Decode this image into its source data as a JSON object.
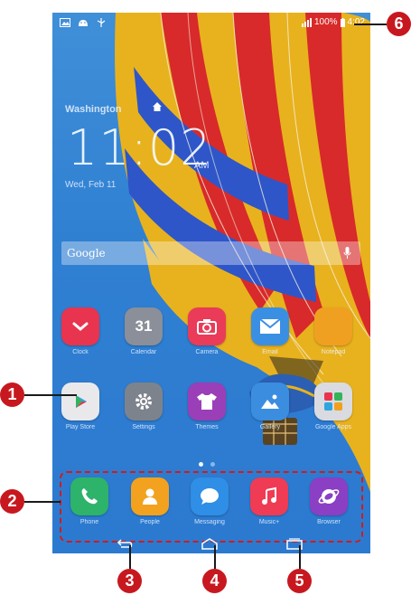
{
  "status_bar": {
    "left_icons": [
      "image-icon",
      "android-icon",
      "usb-icon"
    ],
    "signal": "signal-icon",
    "battery_text": "100%",
    "time": "4:02"
  },
  "widget": {
    "location": "Washington",
    "time": "11:02",
    "ampm": "AM",
    "date": "Wed, Feb 11"
  },
  "search": {
    "logo": "Google"
  },
  "apps_row1": [
    {
      "label": "Clock",
      "icon": "clock-icon",
      "color": "#e8344e"
    },
    {
      "label": "Calendar",
      "icon": "calendar-icon",
      "color": "#8a8f99",
      "text": "31"
    },
    {
      "label": "Camera",
      "icon": "camera-icon",
      "color": "#ea3b58"
    },
    {
      "label": "Email",
      "icon": "email-icon",
      "color": "#3a8fe3"
    },
    {
      "label": "Notepad",
      "icon": "notepad-icon",
      "color": "#f0a020"
    }
  ],
  "apps_row2": [
    {
      "label": "Play Store",
      "icon": "play-store-icon",
      "color": "#e9e9ec"
    },
    {
      "label": "Settings",
      "icon": "settings-icon",
      "color": "#7d838c"
    },
    {
      "label": "Themes",
      "icon": "themes-icon",
      "color": "#9a3fb8"
    },
    {
      "label": "Gallery",
      "icon": "gallery-icon",
      "color": "#3b8de0"
    },
    {
      "label": "Google Apps",
      "icon": "folder-icon",
      "color": "#d9dbe0"
    }
  ],
  "dock": [
    {
      "label": "Phone",
      "icon": "phone-icon",
      "color": "#2db36a"
    },
    {
      "label": "People",
      "icon": "contacts-icon",
      "color": "#f2a21e"
    },
    {
      "label": "Messaging",
      "icon": "messaging-icon",
      "color": "#2f8ee6"
    },
    {
      "label": "Music+",
      "icon": "music-icon",
      "color": "#ef3b54"
    },
    {
      "label": "Browser",
      "icon": "browser-icon",
      "color": "#8a3fc4"
    }
  ],
  "callouts": [
    "1",
    "2",
    "3",
    "4",
    "5",
    "6"
  ],
  "colors": {
    "callout": "#c8181f",
    "dock_border": "#d01c1c"
  }
}
